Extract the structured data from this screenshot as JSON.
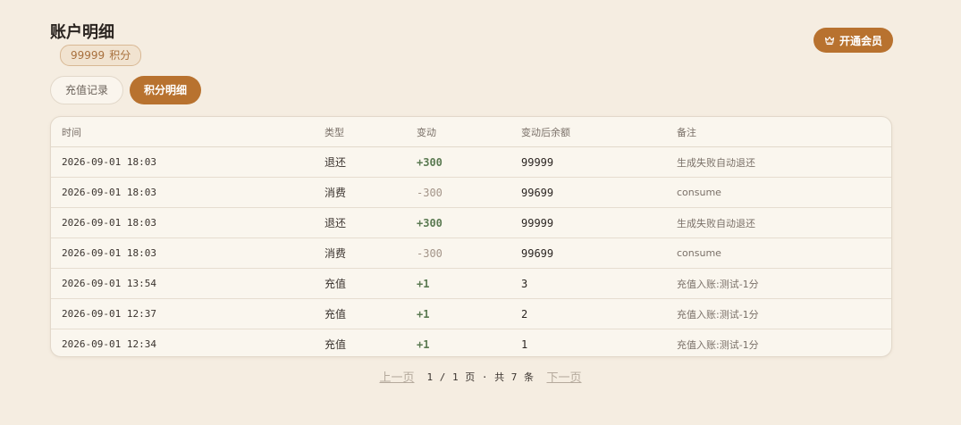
{
  "header": {
    "title": "账户明细",
    "points_value": "99999",
    "points_unit": "积分"
  },
  "vip_button": {
    "label": "开通会员",
    "icon": "crown-icon"
  },
  "tabs": [
    {
      "label": "充值记录",
      "active": false
    },
    {
      "label": "积分明细",
      "active": true
    }
  ],
  "table": {
    "columns": [
      "时间",
      "类型",
      "变动",
      "变动后余额",
      "备注"
    ],
    "rows": [
      {
        "time": "2026-09-01 18:03",
        "type": "退还",
        "change": "+300",
        "balance": "99999",
        "note": "生成失败自动退还"
      },
      {
        "time": "2026-09-01 18:03",
        "type": "消费",
        "change": "-300",
        "balance": "99699",
        "note": "consume"
      },
      {
        "time": "2026-09-01 18:03",
        "type": "退还",
        "change": "+300",
        "balance": "99999",
        "note": "生成失败自动退还"
      },
      {
        "time": "2026-09-01 18:03",
        "type": "消费",
        "change": "-300",
        "balance": "99699",
        "note": "consume"
      },
      {
        "time": "2026-09-01 13:54",
        "type": "充值",
        "change": "+1",
        "balance": "3",
        "note": "充值入账:测试-1分"
      },
      {
        "time": "2026-09-01 12:37",
        "type": "充值",
        "change": "+1",
        "balance": "2",
        "note": "充值入账:测试-1分"
      },
      {
        "time": "2026-09-01 12:34",
        "type": "充值",
        "change": "+1",
        "balance": "1",
        "note": "充值入账:测试-1分"
      }
    ]
  },
  "pagination": {
    "prev_label": "上一页",
    "info": "1 / 1 页 · 共 7 条",
    "next_label": "下一页"
  },
  "colors": {
    "background": "#f5ede1",
    "accent": "#b8722f",
    "positive": "#5b7a52",
    "negative": "#a39488"
  }
}
